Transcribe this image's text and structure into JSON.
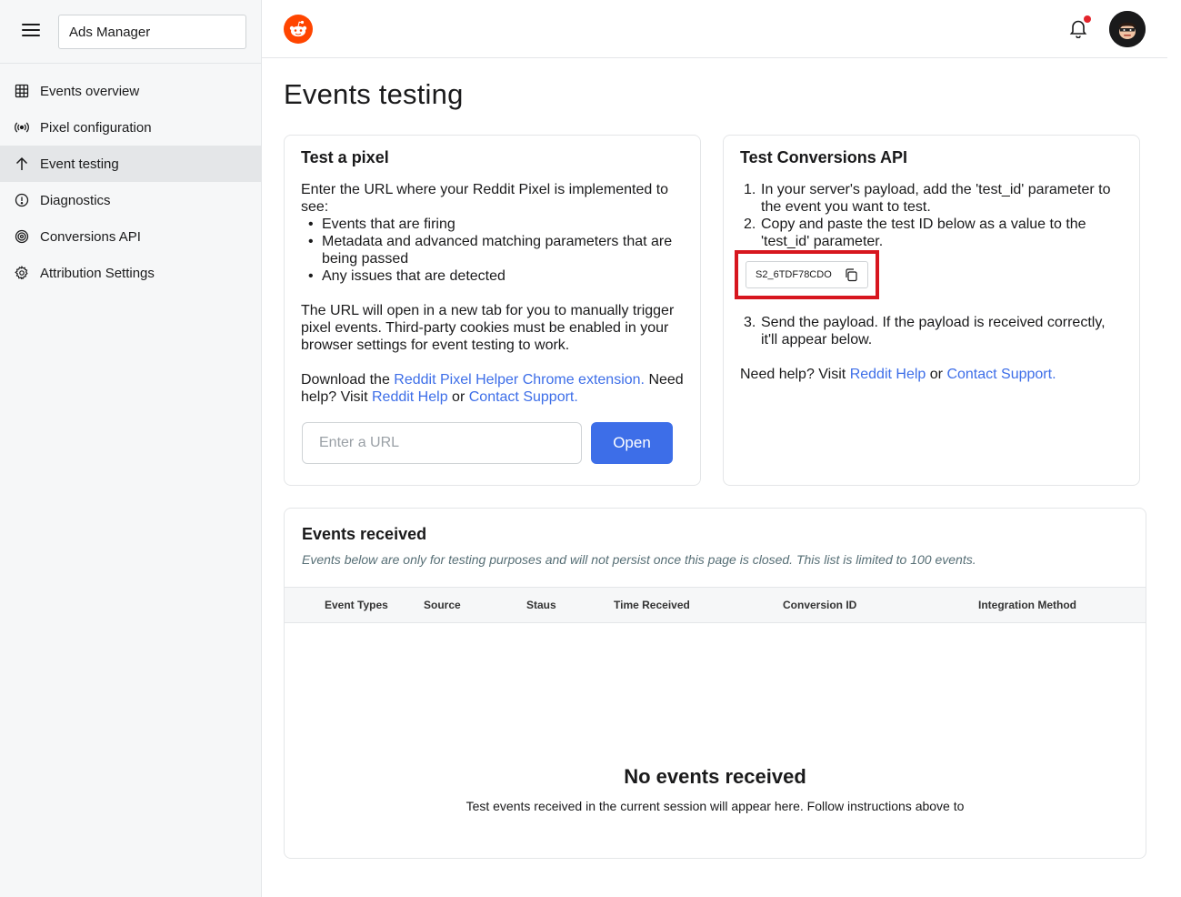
{
  "sidebar": {
    "search_value": "Ads Manager",
    "items": [
      {
        "label": "Events overview",
        "icon": "table-icon"
      },
      {
        "label": "Pixel configuration",
        "icon": "broadcast-icon"
      },
      {
        "label": "Event testing",
        "icon": "arrow-up-icon",
        "active": true
      },
      {
        "label": "Diagnostics",
        "icon": "alert-circle-icon"
      },
      {
        "label": "Conversions API",
        "icon": "target-icon"
      },
      {
        "label": "Attribution Settings",
        "icon": "gear-icon"
      }
    ]
  },
  "header": {
    "has_notification": true
  },
  "page": {
    "title": "Events testing"
  },
  "pixel_card": {
    "title": "Test a pixel",
    "intro": "Enter the URL where your Reddit Pixel is implemented to see:",
    "bullets": [
      "Events that are firing",
      "Metadata and advanced matching parameters that are being passed",
      "Any issues that are detected"
    ],
    "note": "The URL will open in a new tab for you to manually trigger pixel events. Third-party cookies must be enabled in your browser settings for event testing to work.",
    "download_prefix": "Download the",
    "download_link": "Reddit Pixel Helper Chrome extension.",
    "help_prefix": "Need help? Visit",
    "help_link": "Reddit Help",
    "or": "or",
    "support_link": "Contact Support.",
    "url_placeholder": "Enter a URL",
    "url_value": "",
    "open_button": "Open"
  },
  "capi_card": {
    "title": "Test Conversions API",
    "steps": [
      "In your server's payload, add the 'test_id' parameter to the event you want to test.",
      "Copy and paste the test ID below as a value to the 'test_id' parameter.",
      "Send the payload. If the payload is received correctly, it'll appear below."
    ],
    "test_id": "S2_6TDF78CDO",
    "help_prefix": "Need help? Visit",
    "help_link": "Reddit Help",
    "or": "or",
    "support_link": "Contact Support."
  },
  "events_card": {
    "title": "Events received",
    "subtitle": "Events below are only for testing purposes and will not persist once this page is closed. This list is limited to 100 events.",
    "columns": [
      "Event Types",
      "Source",
      "Staus",
      "Time Received",
      "Conversion ID",
      "Integration Method"
    ],
    "empty_title": "No events received",
    "empty_sub": "Test events received in the current session will appear here. Follow instructions above to"
  },
  "colors": {
    "accent": "#3d6ee8",
    "brand": "#ff4500",
    "highlight": "#d7161e"
  }
}
